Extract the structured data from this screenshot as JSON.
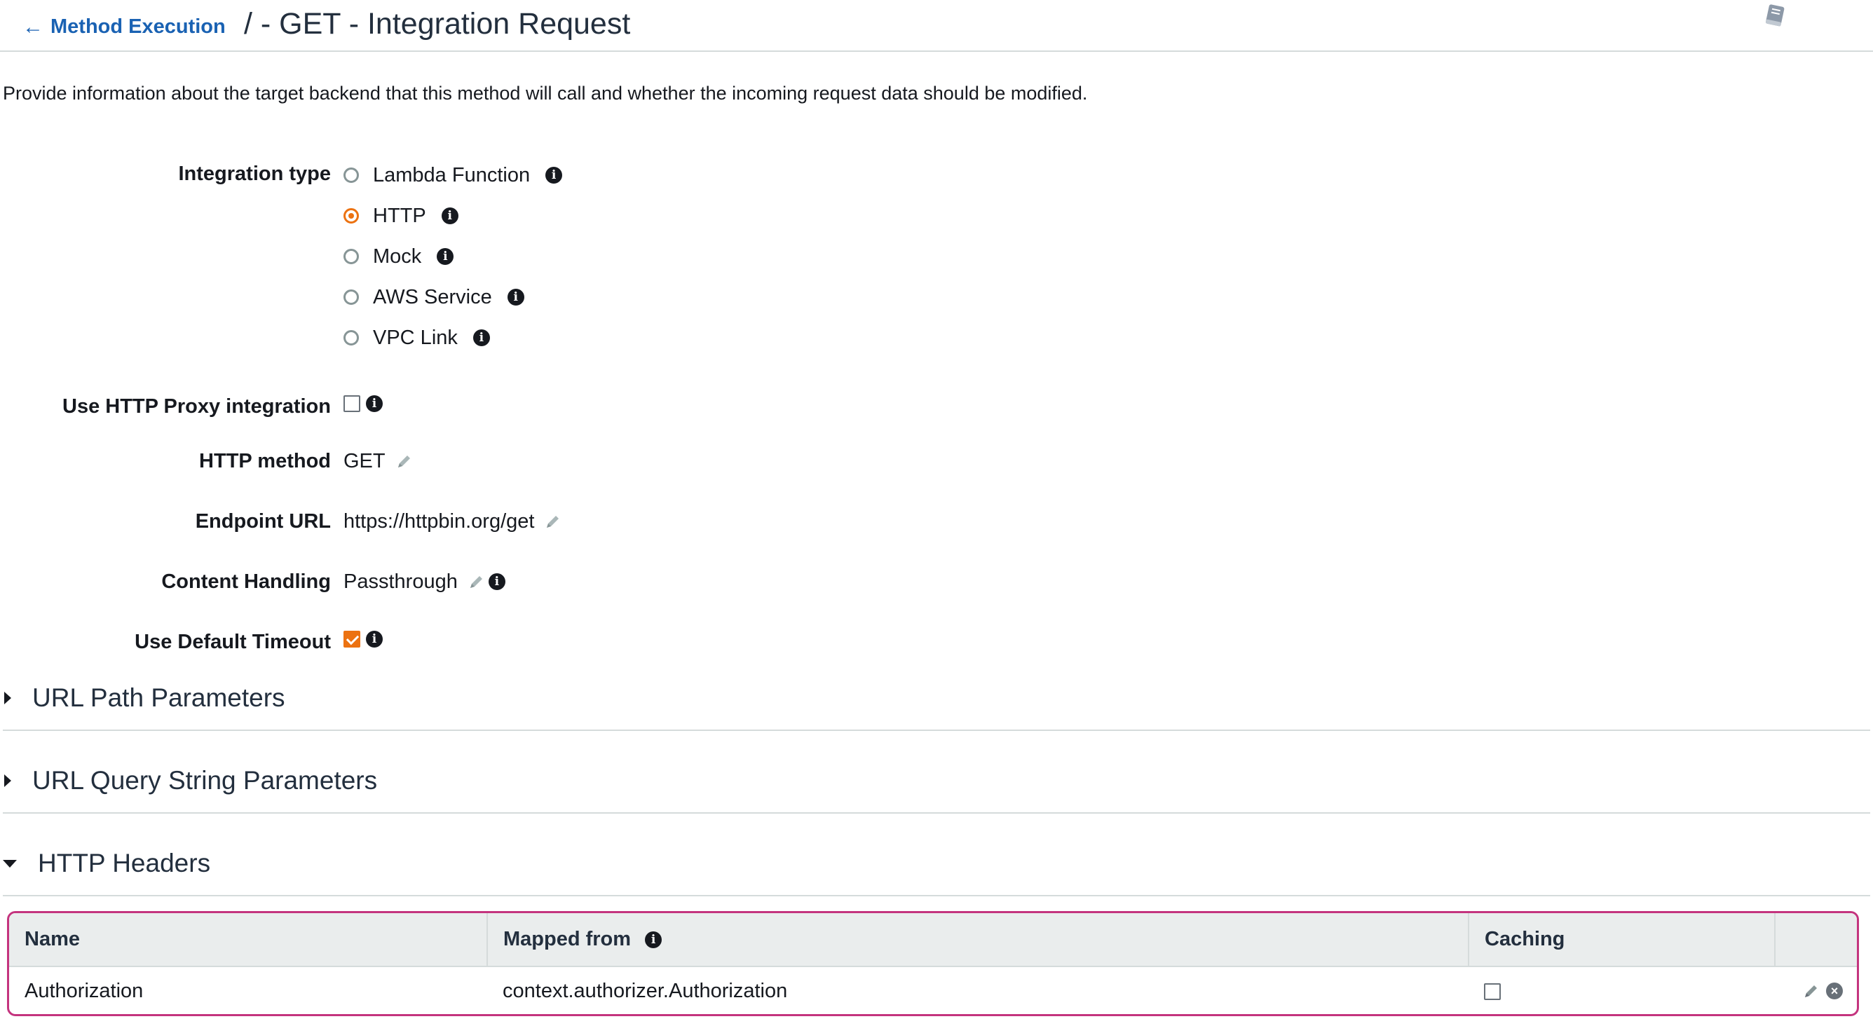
{
  "header": {
    "back_label": "Method Execution",
    "title": "/ - GET - Integration Request",
    "doc_icon": "book-icon"
  },
  "description": "Provide information about the target backend that this method will call and whether the incoming request data should be modified.",
  "form": {
    "integration_type": {
      "label": "Integration type",
      "options": [
        {
          "label": "Lambda Function",
          "selected": false
        },
        {
          "label": "HTTP",
          "selected": true
        },
        {
          "label": "Mock",
          "selected": false
        },
        {
          "label": "AWS Service",
          "selected": false
        },
        {
          "label": "VPC Link",
          "selected": false
        }
      ]
    },
    "proxy": {
      "label": "Use HTTP Proxy integration",
      "checked": false
    },
    "http_method": {
      "label": "HTTP method",
      "value": "GET"
    },
    "endpoint_url": {
      "label": "Endpoint URL",
      "value": "https://httpbin.org/get"
    },
    "content_handling": {
      "label": "Content Handling",
      "value": "Passthrough"
    },
    "default_timeout": {
      "label": "Use Default Timeout",
      "checked": true
    }
  },
  "sections": [
    {
      "title": "URL Path Parameters",
      "expanded": false
    },
    {
      "title": "URL Query String Parameters",
      "expanded": false
    },
    {
      "title": "HTTP Headers",
      "expanded": true
    }
  ],
  "headers_table": {
    "columns": [
      "Name",
      "Mapped from",
      "Caching",
      ""
    ],
    "rows": [
      {
        "name": "Authorization",
        "mapped_from": "context.authorizer.Authorization",
        "caching": false
      }
    ]
  },
  "colors": {
    "accent": "#ec7211",
    "link": "#1a62b3",
    "highlight_border": "#c4347e"
  },
  "icons": {
    "info": "info-icon",
    "edit": "pencil-icon",
    "remove": "close-circle-icon"
  }
}
